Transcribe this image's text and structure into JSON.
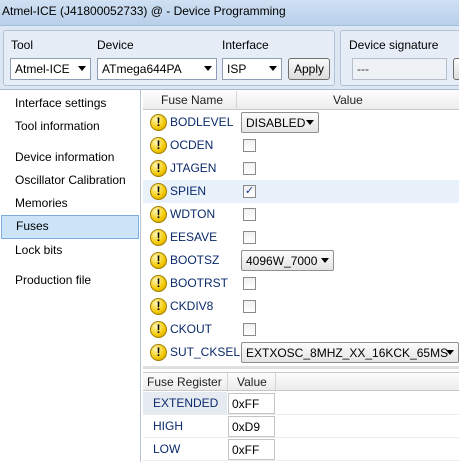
{
  "window": {
    "title": "Atmel-ICE (J41800052733) @  - Device Programming"
  },
  "toolbar": {
    "tool_label": "Tool",
    "tool_value": "Atmel-ICE",
    "device_label": "Device",
    "device_value": "ATmega644PA",
    "interface_label": "Interface",
    "interface_value": "ISP",
    "apply_label": "Apply",
    "signature_label": "Device signature",
    "signature_value": "---"
  },
  "nav": {
    "items": [
      {
        "label": "Interface settings"
      },
      {
        "label": "Tool information"
      },
      {
        "label": "Device information"
      },
      {
        "label": "Oscillator Calibration"
      },
      {
        "label": "Memories"
      },
      {
        "label": "Fuses",
        "selected": true
      },
      {
        "label": "Lock bits"
      },
      {
        "label": "Production file"
      }
    ]
  },
  "fuses": {
    "col_name": "Fuse Name",
    "col_value": "Value",
    "rows": [
      {
        "name": "BODLEVEL",
        "kind": "combo",
        "value": "DISABLED"
      },
      {
        "name": "OCDEN",
        "kind": "check",
        "checked": false
      },
      {
        "name": "JTAGEN",
        "kind": "check",
        "checked": false
      },
      {
        "name": "SPIEN",
        "kind": "check",
        "checked": true
      },
      {
        "name": "WDTON",
        "kind": "check",
        "checked": false
      },
      {
        "name": "EESAVE",
        "kind": "check",
        "checked": false
      },
      {
        "name": "BOOTSZ",
        "kind": "combo",
        "value": "4096W_7000"
      },
      {
        "name": "BOOTRST",
        "kind": "check",
        "checked": false
      },
      {
        "name": "CKDIV8",
        "kind": "check",
        "checked": false
      },
      {
        "name": "CKOUT",
        "kind": "check",
        "checked": false
      },
      {
        "name": "SUT_CKSEL",
        "kind": "combo",
        "value": "EXTXOSC_8MHZ_XX_16KCK_65MS"
      }
    ],
    "warning_glyph": "!",
    "check_glyph": "✓"
  },
  "registers": {
    "col_name": "Fuse Register",
    "col_value": "Value",
    "rows": [
      {
        "name": "EXTENDED",
        "value": "0xFF"
      },
      {
        "name": "HIGH",
        "value": "0xD9"
      },
      {
        "name": "LOW",
        "value": "0xFF"
      }
    ]
  },
  "colors": {
    "selection": "#cce4f7",
    "warning": "#f3c800",
    "link_text": "#0a2a6b"
  },
  "icons": {
    "warning": "warning-icon",
    "dropdown": "chevron-down-icon"
  }
}
